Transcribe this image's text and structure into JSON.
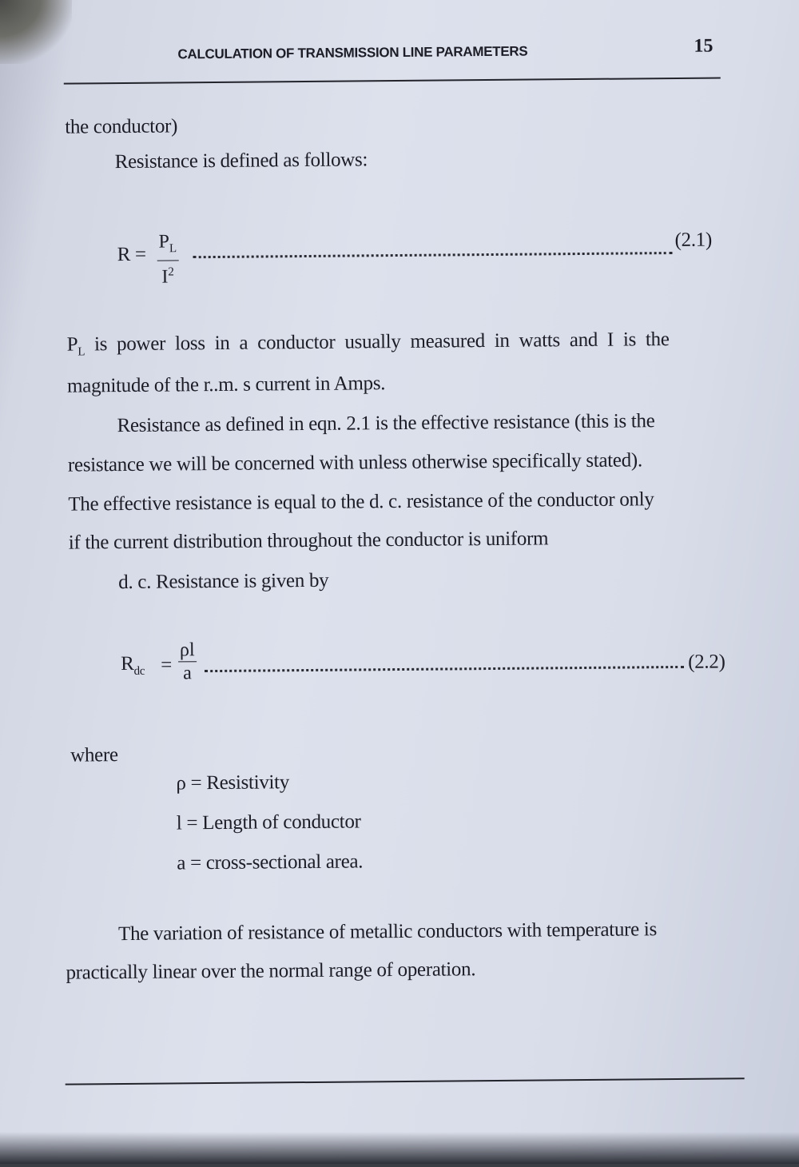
{
  "header": {
    "running_title": "CALCULATION OF TRANSMISSION LINE PARAMETERS",
    "page_number": "15"
  },
  "body": {
    "line1": "the conductor)",
    "line2": "Resistance is defined as follows:",
    "eq1": {
      "lhs": "R =",
      "num_main": "P",
      "num_sub": "L",
      "den_main": "I",
      "den_sup": "2",
      "number": "(2.1)"
    },
    "para1": [
      "P",
      "L",
      " is power loss in a conductor usually measured in watts and I is the",
      "magnitude of the r..m. s current in Amps."
    ],
    "para2": [
      "Resistance as defined in eqn. 2.1 is the effective resistance (this is the",
      "resistance we will be concerned with unless otherwise specifically stated).",
      "The effective resistance is equal to the d. c. resistance of the conductor only",
      "if the current distribution throughout the conductor is uniform"
    ],
    "line_dc": "d. c. Resistance is given by",
    "eq2": {
      "lhs_main": "R",
      "lhs_sub": "dc",
      "eq": "=",
      "num": "ρl",
      "den": "a",
      "number": "(2.2)"
    },
    "where": "where",
    "definitions": [
      "ρ = Resistivity",
      "l = Length of conductor",
      "a = cross-sectional area."
    ],
    "para3": [
      "The variation of resistance of metallic conductors with temperature is",
      "practically linear over the normal range of operation."
    ]
  }
}
